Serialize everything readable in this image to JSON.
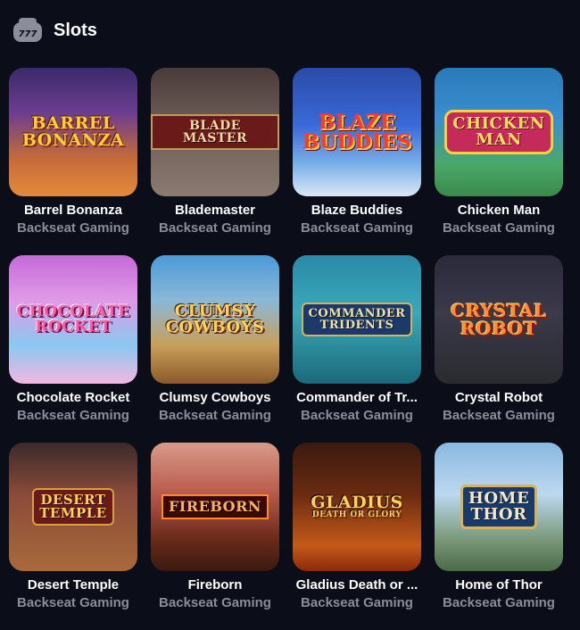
{
  "header": {
    "icon": "slot-777-icon",
    "title": "Slots"
  },
  "games": [
    {
      "name": "Barrel Bonanza",
      "provider": "Backseat Gaming",
      "logo_line1": "BARREL",
      "logo_line2": "BONANZA"
    },
    {
      "name": "Blademaster",
      "provider": "Backseat Gaming",
      "logo_line1": "BLADE MASTER",
      "logo_line2": ""
    },
    {
      "name": "Blaze Buddies",
      "provider": "Backseat Gaming",
      "logo_line1": "BLAZE",
      "logo_line2": "BUDDIES"
    },
    {
      "name": "Chicken Man",
      "provider": "Backseat Gaming",
      "logo_line1": "CHICKEN",
      "logo_line2": "MAN"
    },
    {
      "name": "Chocolate Rocket",
      "provider": "Backseat Gaming",
      "logo_line1": "CHOCOLATE",
      "logo_line2": "ROCKET"
    },
    {
      "name": "Clumsy Cowboys",
      "provider": "Backseat Gaming",
      "logo_line1": "CLUMSY",
      "logo_line2": "COWBOYS"
    },
    {
      "name": "Commander of Tr...",
      "provider": "Backseat Gaming",
      "logo_line1": "COMMANDER",
      "logo_line2": "TRIDENTS"
    },
    {
      "name": "Crystal Robot",
      "provider": "Backseat Gaming",
      "logo_line1": "CRYSTAL",
      "logo_line2": "ROBOT"
    },
    {
      "name": "Desert Temple",
      "provider": "Backseat Gaming",
      "logo_line1": "DESERT",
      "logo_line2": "TEMPLE"
    },
    {
      "name": "Fireborn",
      "provider": "Backseat Gaming",
      "logo_line1": "FIREBORN",
      "logo_line2": ""
    },
    {
      "name": "Gladius Death or ...",
      "provider": "Backseat Gaming",
      "logo_line1": "GLADIUS",
      "logo_line2": "DEATH OR GLORY"
    },
    {
      "name": "Home of Thor",
      "provider": "Backseat Gaming",
      "logo_line1": "HOME",
      "logo_line2": "THOR"
    }
  ]
}
